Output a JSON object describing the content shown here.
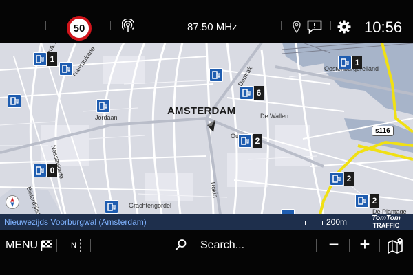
{
  "status_bar": {
    "speed_limit": "50",
    "radio_frequency": "87.50 MHz",
    "clock": "10:56",
    "icons": [
      "radio-broadcast-icon",
      "location-pin-icon",
      "message-icon",
      "gear-icon"
    ]
  },
  "map": {
    "city_label": "AMSTERDAM",
    "street_labels": {
      "frederik": "Frederik Hendrikstraat",
      "nassaukade_top": "Nassaukade",
      "nassaukade_mid": "Nassaukade",
      "jordaan": "Jordaan",
      "de_wallen": "De Wallen",
      "oosterdok": "Oostenburgereiland",
      "bilderdijk": "Bilderdijkstraat",
      "grachtengordel": "Grachtengordel",
      "rokin": "Rokin",
      "damrak": "Damrak",
      "oude": "Ou",
      "noordelijk": "De Plantage"
    },
    "road_shield": "s116",
    "charging_clusters": [
      "1",
      "6",
      "1",
      "2",
      "0",
      "2",
      "2"
    ],
    "colors": {
      "background": "#d9dbe3",
      "water": "#a7b4c9",
      "major_road": "#f0e014",
      "poi": "#1f5db0"
    }
  },
  "info_strip": {
    "current_street": "Nieuwezijds Voorburgwal (Amsterdam)",
    "scale": "200m",
    "logo_line1": "TomTom",
    "logo_line2": "TRAFFIC"
  },
  "bottom_bar": {
    "menu_label": "MENU",
    "north_up_label": "N",
    "search_label": "Search...",
    "zoom_out_label": "−",
    "zoom_in_label": "+"
  }
}
